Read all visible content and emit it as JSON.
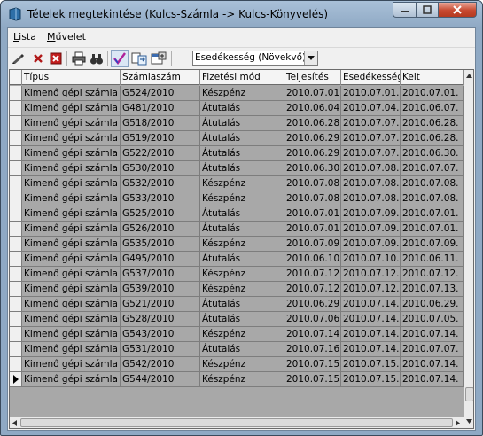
{
  "window": {
    "title": "Tételek megtekintése (Kulcs-Számla -> Kulcs-Könyvelés)"
  },
  "menu": {
    "items": [
      {
        "label": "Lista",
        "accel": "L",
        "rest": "ista"
      },
      {
        "label": "Művelet",
        "accel": "M",
        "rest": "űvelet"
      }
    ]
  },
  "toolbar": {
    "icons": [
      "pen-icon",
      "cross-icon",
      "delete-icon",
      "printer-icon",
      "binoculars-icon",
      "checkmark-icon",
      "export-icon",
      "settings-icon"
    ],
    "sort_value": "Esedékesség (Növekvő)"
  },
  "table": {
    "columns": [
      "Típus",
      "Számlaszám",
      "Fizetési mód",
      "Teljesítés",
      "Esedékesség",
      "Kelt"
    ],
    "rows": [
      [
        "Kimenő gépi számla",
        "G524/2010",
        "Készpénz",
        "2010.07.01.",
        "2010.07.01.",
        "2010.07.01."
      ],
      [
        "Kimenő gépi számla",
        "G481/2010",
        "Átutalás",
        "2010.06.04.",
        "2010.07.04.",
        "2010.06.07."
      ],
      [
        "Kimenő gépi számla",
        "G518/2010",
        "Átutalás",
        "2010.06.28.",
        "2010.07.07.",
        "2010.06.28."
      ],
      [
        "Kimenő gépi számla",
        "G519/2010",
        "Átutalás",
        "2010.06.29.",
        "2010.07.07.",
        "2010.06.28."
      ],
      [
        "Kimenő gépi számla",
        "G522/2010",
        "Átutalás",
        "2010.06.29.",
        "2010.07.07.",
        "2010.06.30."
      ],
      [
        "Kimenő gépi számla",
        "G530/2010",
        "Átutalás",
        "2010.06.30.",
        "2010.07.08.",
        "2010.07.07."
      ],
      [
        "Kimenő gépi számla",
        "G532/2010",
        "Készpénz",
        "2010.07.08.",
        "2010.07.08.",
        "2010.07.08."
      ],
      [
        "Kimenő gépi számla",
        "G533/2010",
        "Készpénz",
        "2010.07.08.",
        "2010.07.08.",
        "2010.07.08."
      ],
      [
        "Kimenő gépi számla",
        "G525/2010",
        "Átutalás",
        "2010.07.01.",
        "2010.07.09.",
        "2010.07.01."
      ],
      [
        "Kimenő gépi számla",
        "G526/2010",
        "Átutalás",
        "2010.07.01.",
        "2010.07.09.",
        "2010.07.01."
      ],
      [
        "Kimenő gépi számla",
        "G535/2010",
        "Készpénz",
        "2010.07.09.",
        "2010.07.09.",
        "2010.07.09."
      ],
      [
        "Kimenő gépi számla",
        "G495/2010",
        "Átutalás",
        "2010.06.10.",
        "2010.07.10.",
        "2010.06.11."
      ],
      [
        "Kimenő gépi számla",
        "G537/2010",
        "Készpénz",
        "2010.07.12.",
        "2010.07.12.",
        "2010.07.12."
      ],
      [
        "Kimenő gépi számla",
        "G539/2010",
        "Készpénz",
        "2010.07.12.",
        "2010.07.12.",
        "2010.07.13."
      ],
      [
        "Kimenő gépi számla",
        "G521/2010",
        "Átutalás",
        "2010.06.29.",
        "2010.07.14.",
        "2010.06.29."
      ],
      [
        "Kimenő gépi számla",
        "G528/2010",
        "Átutalás",
        "2010.07.06.",
        "2010.07.14.",
        "2010.07.05."
      ],
      [
        "Kimenő gépi számla",
        "G543/2010",
        "Készpénz",
        "2010.07.14.",
        "2010.07.14.",
        "2010.07.14."
      ],
      [
        "Kimenő gépi számla",
        "G531/2010",
        "Átutalás",
        "2010.07.16.",
        "2010.07.14.",
        "2010.07.07."
      ],
      [
        "Kimenő gépi számla",
        "G542/2010",
        "Készpénz",
        "2010.07.15.",
        "2010.07.15.",
        "2010.07.14."
      ],
      [
        "Kimenő gépi számla",
        "G544/2010",
        "Készpénz",
        "2010.07.15.",
        "2010.07.15.",
        "2010.07.14."
      ]
    ],
    "current_row_index": 19
  },
  "colors": {
    "row_bg": "#a8a8a8",
    "header_bg": "#f4f4f4",
    "title_bg": "#8fa9c4",
    "close_btn": "#c7482f"
  }
}
